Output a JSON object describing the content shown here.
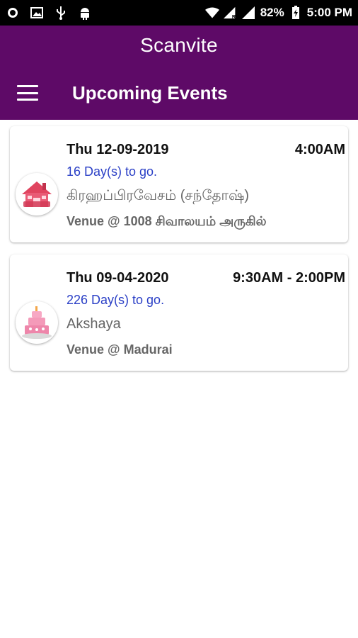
{
  "status_bar": {
    "left_icons": [
      "record-icon",
      "image-icon",
      "usb-icon",
      "android-icon"
    ],
    "right_icons": [
      "wifi-icon",
      "signal-r-icon",
      "signal-icon",
      "battery-charging-icon"
    ],
    "battery_percent": "82%",
    "time": "5:00 PM"
  },
  "app": {
    "title": "Scanvite",
    "page_title": "Upcoming Events",
    "menu_icon": "hamburger-menu-icon",
    "primary_color": "#5e0a67"
  },
  "events": [
    {
      "date": "Thu 12-09-2019",
      "time": "4:00AM",
      "days_to_go": "16 Day(s) to go.",
      "name": "கிரஹப்பிரவேசம் (சந்தோஷ்)",
      "venue": "Venue @ 1008 சிவாலயம் அருகில்",
      "icon": "house-warming-icon"
    },
    {
      "date": "Thu 09-04-2020",
      "time": "9:30AM - 2:00PM",
      "days_to_go": "226 Day(s) to go.",
      "name": "Akshaya",
      "venue": "Venue @ Madurai",
      "icon": "birthday-cake-icon"
    }
  ],
  "colors": {
    "days_to_go": "#2a3fc6",
    "secondary_text": "#666666"
  }
}
